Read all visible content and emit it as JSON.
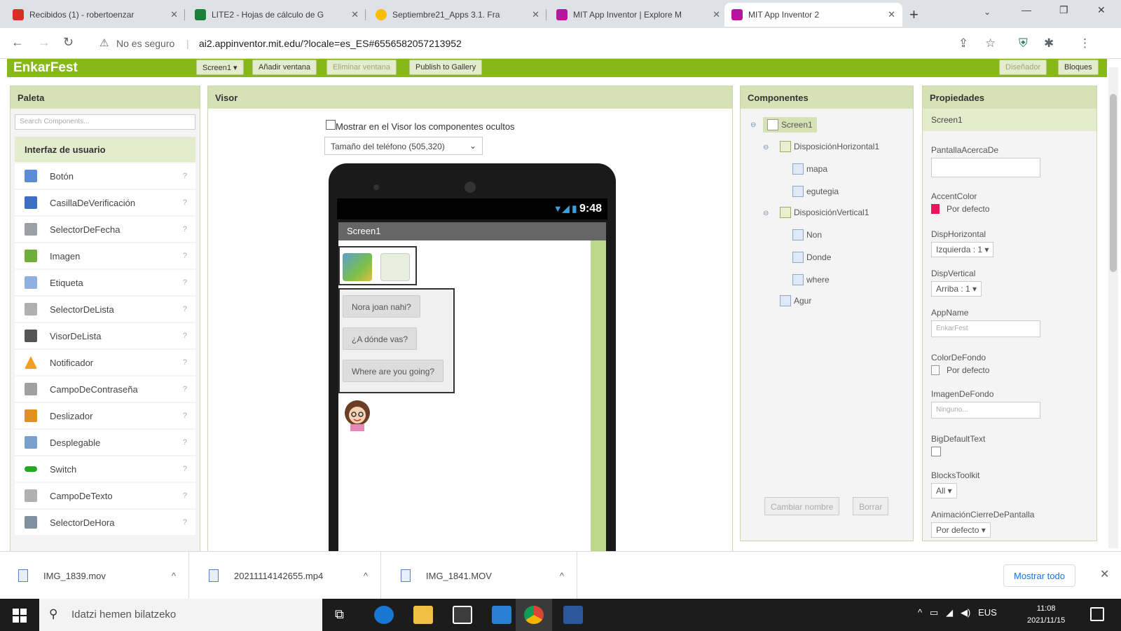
{
  "browser": {
    "tabs": [
      {
        "title": "Recibidos (1) - robertoenzar",
        "icon_color": "#d93025"
      },
      {
        "title": "LITE2 - Hojas de cálculo de G",
        "icon_color": "#188038"
      },
      {
        "title": "Septiembre21_Apps 3.1. Fra",
        "icon_color": "#5f6368"
      },
      {
        "title": "MIT App Inventor | Explore M",
        "icon_color": "#b5179e"
      },
      {
        "title": "MIT App Inventor 2",
        "icon_color": "#b5179e"
      }
    ],
    "new_tab": "+",
    "minimize": "—",
    "restore": "❐",
    "close": "✕",
    "back": "←",
    "forward": "→",
    "reload": "↻",
    "not_secure": "No es seguro",
    "separator": "|",
    "url": "ai2.appinventor.mit.edu/?locale=es_ES#6556582057213952"
  },
  "app": {
    "name": "EnkarFest",
    "screen_select": "Screen1 ▾",
    "add_window": "Añadir ventana",
    "remove_window": "Eliminar ventana",
    "publish": "Publish to Gallery",
    "designer": "Diseñador",
    "blocks": "Bloques",
    "accent": "#86b817"
  },
  "palette": {
    "title": "Paleta",
    "search_placeholder": "Search Components...",
    "category": "Interfaz de usuario",
    "info_glyph": "?",
    "items": [
      {
        "label": "Botón",
        "color": "#5b8dd6"
      },
      {
        "label": "CasillaDeVerificación",
        "color": "#3a6fc4"
      },
      {
        "label": "SelectorDeFecha",
        "color": "#9aa0a6"
      },
      {
        "label": "Imagen",
        "color": "#6fae3b"
      },
      {
        "label": "Etiqueta",
        "color": "#8fb0e0"
      },
      {
        "label": "SelectorDeLista",
        "color": "#b0b0b0"
      },
      {
        "label": "VisorDeLista",
        "color": "#555555"
      },
      {
        "label": "Notificador",
        "color": "#f0a020"
      },
      {
        "label": "CampoDeContraseña",
        "color": "#a0a0a0"
      },
      {
        "label": "Deslizador",
        "color": "#e09020"
      },
      {
        "label": "Desplegable",
        "color": "#7aa0d0"
      },
      {
        "label": "Switch",
        "color": "#22aa22"
      },
      {
        "label": "CampoDeTexto",
        "color": "#b0b0b0"
      },
      {
        "label": "SelectorDeHora",
        "color": "#8090a0"
      }
    ]
  },
  "viewer": {
    "title": "Visor",
    "show_hidden": "Mostrar en el Visor los componentes ocultos",
    "phone_size": "Tamaño del teléfono (505,320)",
    "status_time": "9:48",
    "screen_title": "Screen1",
    "buttons": [
      "Nora joan nahi?",
      "¿A dónde vas?",
      "Where are you going?"
    ]
  },
  "components": {
    "title": "Componentes",
    "expand_glyph": "⊖",
    "tree": [
      {
        "label": "Screen1",
        "level": 0
      },
      {
        "label": "DisposiciónHorizontal1",
        "level": 1
      },
      {
        "label": "mapa",
        "level": 2
      },
      {
        "label": "egutegia",
        "level": 2
      },
      {
        "label": "DisposiciónVertical1",
        "level": 1
      },
      {
        "label": "Non",
        "level": 2
      },
      {
        "label": "Donde",
        "level": 2
      },
      {
        "label": "where",
        "level": 2
      },
      {
        "label": "Agur",
        "level": 1
      }
    ],
    "rename": "Cambiar nombre",
    "delete": "Borrar"
  },
  "properties": {
    "title": "Propiedades",
    "component": "Screen1",
    "about_label": "PantallaAcercaDe",
    "about_value": "",
    "accent_label": "AccentColor",
    "accent_value": "Por defecto",
    "accent_color": "#e8175d",
    "halign_label": "DispHorizontal",
    "halign_value": "Izquierda : 1 ▾",
    "valign_label": "DispVertical",
    "valign_value": "Arriba : 1 ▾",
    "appname_label": "AppName",
    "appname_value": "EnkarFest",
    "bgcolor_label": "ColorDeFondo",
    "bgcolor_value": "Por defecto",
    "bgimage_label": "ImagenDeFondo",
    "bgimage_value": "Ninguno...",
    "bigtext_label": "BigDefaultText",
    "toolkit_label": "BlocksToolkit",
    "toolkit_value": "All ▾",
    "closeanim_label": "AnimaciónCierreDePantalla",
    "closeanim_value": "Por defecto ▾"
  },
  "downloads": {
    "items": [
      {
        "name": "IMG_1839.mov"
      },
      {
        "name": "20211114142655.mp4"
      },
      {
        "name": "IMG_1841.MOV"
      }
    ],
    "chevron": "^",
    "show_all": "Mostrar todo",
    "close": "✕"
  },
  "taskbar": {
    "search_placeholder": "Idatzi hemen bilatzeko",
    "lang": "EUS",
    "time": "11:08",
    "date": "2021/11/15",
    "tray_arrow": "^"
  }
}
